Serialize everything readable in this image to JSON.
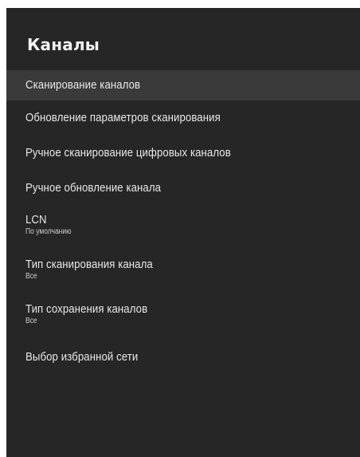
{
  "header": {
    "title": "Каналы"
  },
  "menu": {
    "items": [
      {
        "label": "Сканирование каналов",
        "sub": ""
      },
      {
        "label": "Обновление параметров сканирования",
        "sub": ""
      },
      {
        "label": "Ручное сканирование цифровых каналов",
        "sub": ""
      },
      {
        "label": "Ручное обновление канала",
        "sub": ""
      },
      {
        "label": "LCN",
        "sub": "По умолчанию"
      },
      {
        "label": "Тип сканирования канала",
        "sub": "Все"
      },
      {
        "label": "Тип сохранения каналов",
        "sub": "Все"
      },
      {
        "label": "Выбор избранной сети",
        "sub": ""
      }
    ]
  },
  "colors": {
    "panel_bg": "#262626",
    "selected_bg": "#3a3a3a",
    "text": "#e8e8e8"
  }
}
